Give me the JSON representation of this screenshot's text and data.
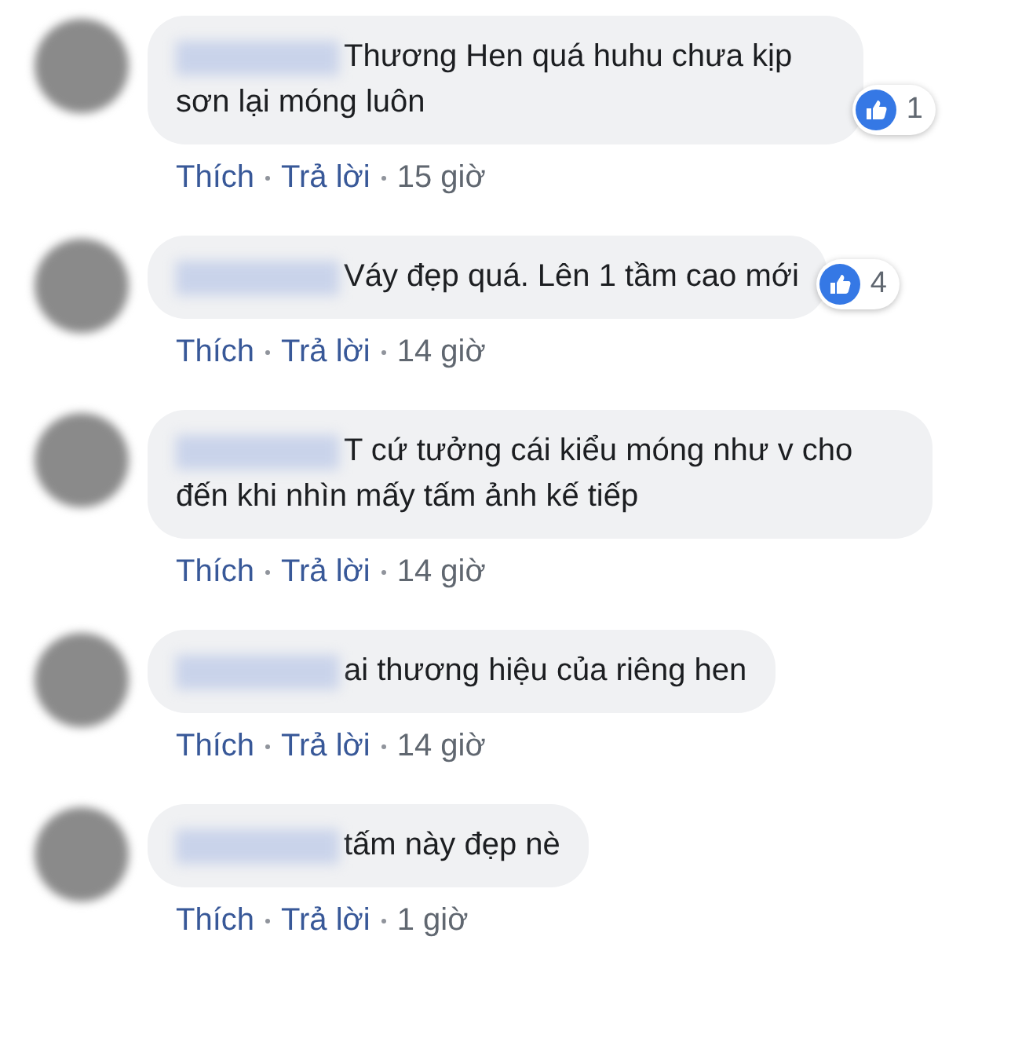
{
  "comments": [
    {
      "text": "Thương Hen quá huhu chưa kịp sơn lại móng luôn",
      "likes": "1",
      "actions": [
        "Thích",
        "Trả lời"
      ],
      "time": "15 giờ"
    },
    {
      "text": "Váy đẹp quá. Lên 1 tầm cao mới",
      "likes": "4",
      "actions": [
        "Thích",
        "Trả lời"
      ],
      "time": "14 giờ"
    },
    {
      "text": "T cứ tưởng cái kiểu móng như v cho đến khi nhìn mấy tấm ảnh kế tiếp",
      "actions": [
        "Thích",
        "Trả lời"
      ],
      "time": "14 giờ"
    },
    {
      "text": "ai thương hiệu của riêng hen",
      "actions": [
        "Thích",
        "Trả lời"
      ],
      "time": "14 giờ"
    },
    {
      "text": "tấm này đẹp nè",
      "actions": [
        "Thích",
        "Trả lời"
      ],
      "time": "1 giờ"
    }
  ]
}
